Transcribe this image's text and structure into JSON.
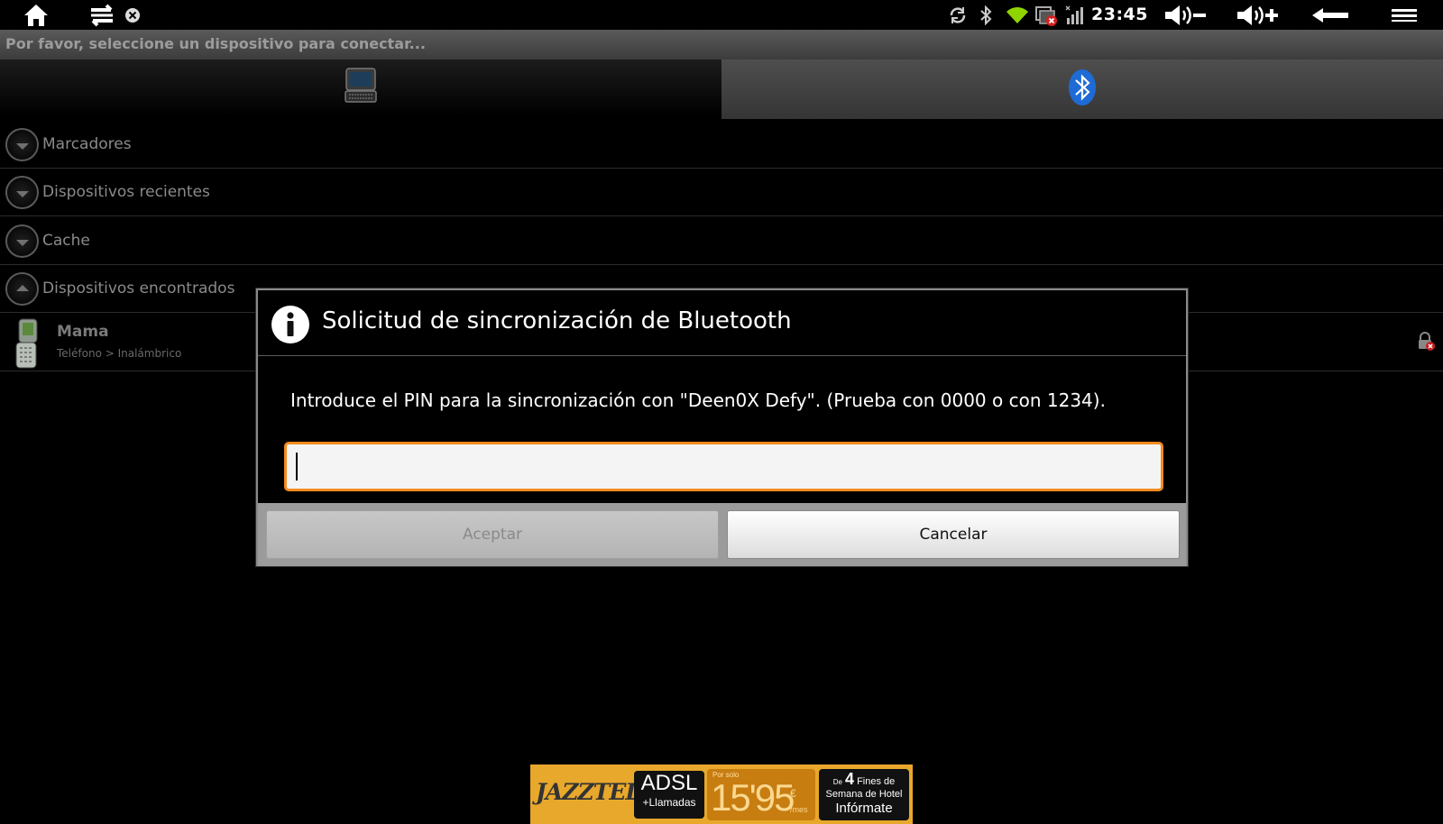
{
  "status_bar": {
    "time": "23:45",
    "icons": [
      "home-icon",
      "multitask-icon",
      "close-icon",
      "sync-icon",
      "bluetooth-icon",
      "wifi-icon",
      "no-sim-icon",
      "signal-icon",
      "volume-down-icon",
      "volume-up-icon",
      "back-icon",
      "menu-icon"
    ]
  },
  "title_bar": {
    "text": "Por favor, seleccione un dispositivo para conectar..."
  },
  "tabs": [
    {
      "icon": "device-icon",
      "selected": true
    },
    {
      "icon": "bluetooth-icon",
      "selected": false
    }
  ],
  "sections": [
    {
      "label": "Marcadores",
      "expanded": false
    },
    {
      "label": "Dispositivos recientes",
      "expanded": false
    },
    {
      "label": "Cache",
      "expanded": false
    },
    {
      "label": "Dispositivos encontrados",
      "expanded": true
    }
  ],
  "devices": [
    {
      "name": "Mama",
      "subtitle": "Teléfono > Inalámbrico",
      "icon": "phone-icon",
      "status_icon": "unpaired-lock-icon"
    }
  ],
  "dialog": {
    "title": "Solicitud de sincronización de Bluetooth",
    "message": "Introduce el PIN para la sincronización con \"Deen0X Defy\". (Prueba con 0000 o con 1234).",
    "pin_value": "",
    "accept_label": "Aceptar",
    "cancel_label": "Cancelar"
  },
  "ad": {
    "brand": "JAZZTEL",
    "product": "ADSL",
    "product_sub": "+Llamadas",
    "price_prefix": "Por solo",
    "price": "15'95",
    "currency": "€",
    "period": "/mes",
    "promo_line1_prefix": "De",
    "promo_number": "4",
    "promo_line1": "Fines de",
    "promo_line2": "Semana de Hotel",
    "cta": "Infórmate"
  },
  "colors": {
    "accent": "#f28c1e",
    "bluetooth": "#1e6bd6"
  }
}
